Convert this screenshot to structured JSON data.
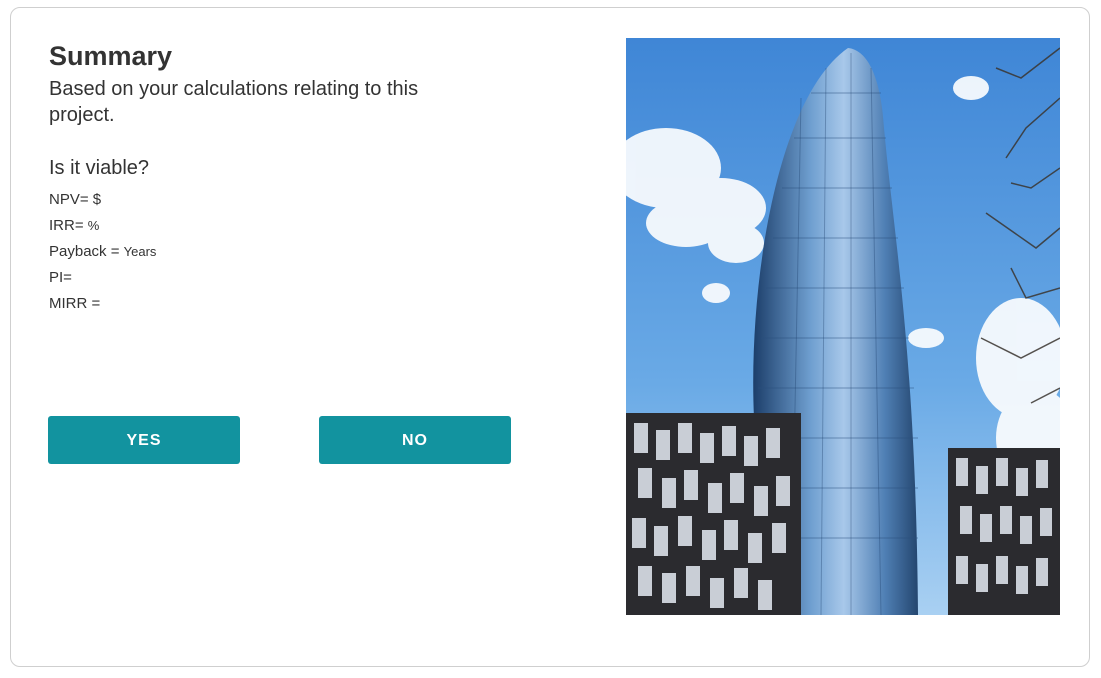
{
  "summary": {
    "title": "Summary",
    "subtitle": "Based on your calculations relating to this project.",
    "question": "Is it viable?"
  },
  "metrics": {
    "npv": {
      "label": "NPV= ",
      "unit": "$"
    },
    "irr": {
      "label": "IRR= ",
      "unit": "%"
    },
    "payback": {
      "label": "Payback = ",
      "unit": "Years"
    },
    "pi": {
      "label": "PI=",
      "unit": ""
    },
    "mirr": {
      "label": "MIRR =",
      "unit": ""
    }
  },
  "buttons": {
    "yes_label": "YES",
    "no_label": "NO"
  },
  "colors": {
    "button": "#12939f",
    "text": "#333333",
    "card_border": "#cfcfcf"
  }
}
